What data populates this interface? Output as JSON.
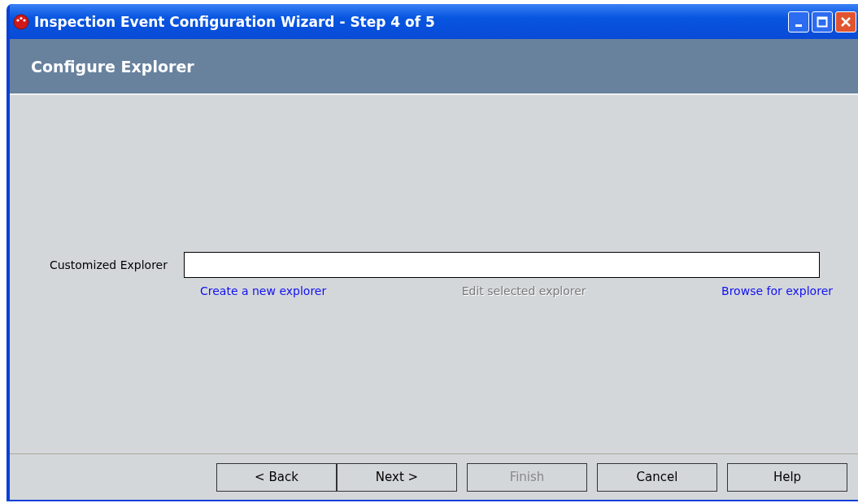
{
  "window": {
    "title": "Inspection Event Configuration Wizard - Step 4 of 5"
  },
  "header": {
    "title": "Configure Explorer"
  },
  "field": {
    "label": "Customized Explorer"
  },
  "links": [
    {
      "label": "Create a new explorer",
      "disabled": false
    },
    {
      "label": "Edit selected explorer",
      "disabled": true
    },
    {
      "label": "Browse for explorer",
      "disabled": false
    }
  ],
  "buttons": [
    {
      "label": "< Back",
      "disabled": false
    },
    {
      "label": "Next >",
      "disabled": false
    },
    {
      "label": "Finish",
      "disabled": true
    },
    {
      "label": "Cancel",
      "disabled": false
    },
    {
      "label": "Help",
      "disabled": false
    }
  ]
}
